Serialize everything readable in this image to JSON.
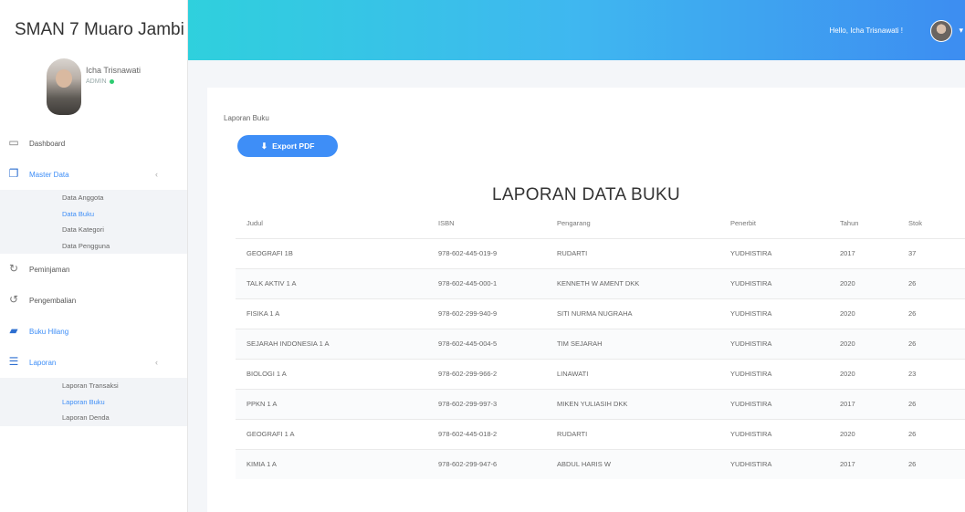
{
  "brand": {
    "name": "SMAN 7 Muaro Jambi"
  },
  "user": {
    "name": "Icha Trisnawati",
    "role": "ADMIN"
  },
  "sidebar": {
    "items": [
      {
        "label": "Dashboard",
        "icon": "monitor-icon"
      },
      {
        "label": "Master Data",
        "icon": "copy-icon",
        "expanded": true,
        "sub": [
          "Data Anggota",
          "Data Buku",
          "Data Kategori",
          "Data Pengguna"
        ]
      },
      {
        "label": "Peminjaman",
        "icon": "refresh-icon"
      },
      {
        "label": "Pengembalian",
        "icon": "undo-icon"
      },
      {
        "label": "Buku Hilang",
        "icon": "book-icon"
      },
      {
        "label": "Laporan",
        "icon": "list-icon",
        "expanded": true,
        "sub": [
          "Laporan Transaksi",
          "Laporan Buku",
          "Laporan Denda"
        ]
      }
    ],
    "active_sub": "Laporan Buku"
  },
  "topbar": {
    "greeting": "Hello, Icha Trisnawati !"
  },
  "content": {
    "breadcrumb": "Laporan Buku",
    "export_label": "Export PDF",
    "report_title": "LAPORAN DATA BUKU"
  },
  "table": {
    "headers": [
      "Judul",
      "ISBN",
      "Pengarang",
      "Penerbit",
      "Tahun",
      "Stok"
    ],
    "rows": [
      [
        "GEOGRAFI 1B",
        "978-602-445-019-9",
        "RUDARTI",
        "YUDHISTIRA",
        "2017",
        "37"
      ],
      [
        "TALK AKTIV 1 A",
        "978-602-445-000-1",
        "KENNETH W AMENT DKK",
        "YUDHISTIRA",
        "2020",
        "26"
      ],
      [
        "FISIKA 1 A",
        "978-602-299-940-9",
        "SITI NURMA NUGRAHA",
        "YUDHISTIRA",
        "2020",
        "26"
      ],
      [
        "SEJARAH INDONESIA 1 A",
        "978-602-445-004-5",
        "TIM SEJARAH",
        "YUDHISTIRA",
        "2020",
        "26"
      ],
      [
        "BIOLOGI 1 A",
        "978-602-299-966-2",
        "LINAWATI",
        "YUDHISTIRA",
        "2020",
        "23"
      ],
      [
        "PPKN 1 A",
        "978-602-299-997-3",
        "MIKEN YULIASIH DKK",
        "YUDHISTIRA",
        "2017",
        "26"
      ],
      [
        "GEOGRAFI 1 A",
        "978-602-445-018-2",
        "RUDARTI",
        "YUDHISTIRA",
        "2020",
        "26"
      ],
      [
        "KIMIA 1 A",
        "978-602-299-947-6",
        "ABDUL HARIS W",
        "YUDHISTIRA",
        "2017",
        "26"
      ]
    ]
  },
  "colors": {
    "accent": "#3e8ef7",
    "topbar_start": "#2fd0dd",
    "topbar_end": "#3d8df1"
  }
}
